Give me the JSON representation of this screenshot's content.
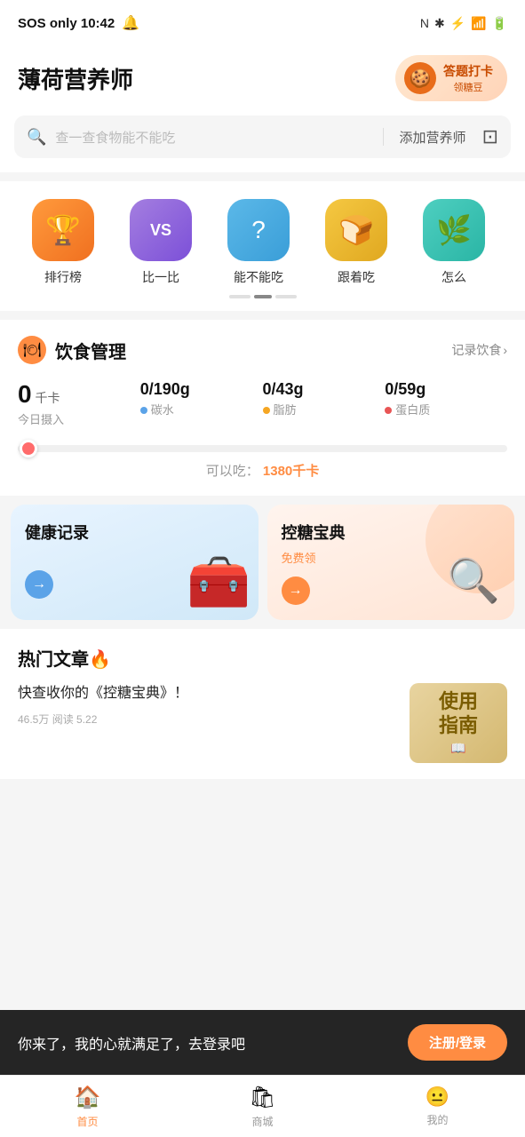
{
  "statusBar": {
    "leftText": "SOS only  10:42",
    "bellIcon": "🔔",
    "rightIcons": "N  *  |||  ◉  🔋"
  },
  "header": {
    "title": "薄荷营养师",
    "badge": {
      "icon": "🍪",
      "mainLabel": "答题打卡",
      "subLabel": "领糖豆"
    }
  },
  "search": {
    "placeholder": "查一查食物能不能吃",
    "addLabel": "添加营养师",
    "scanIcon": "⊡"
  },
  "categories": [
    {
      "id": "ranking",
      "label": "排行榜",
      "icon": "🏆",
      "colorClass": "cat-icon-orange"
    },
    {
      "id": "compare",
      "label": "比一比",
      "icon": "VS",
      "colorClass": "cat-icon-purple"
    },
    {
      "id": "canyoueat",
      "label": "能不能吃",
      "icon": "❓",
      "colorClass": "cat-icon-blue"
    },
    {
      "id": "followeat",
      "label": "跟着吃",
      "icon": "🍞",
      "colorClass": "cat-icon-yellow"
    },
    {
      "id": "howeat",
      "label": "怎么",
      "icon": "🌿",
      "colorClass": "cat-icon-teal"
    }
  ],
  "dietManagement": {
    "title": "饮食管理",
    "linkLabel": "记录饮食",
    "linkArrow": ">",
    "stats": [
      {
        "id": "calories",
        "main": "0",
        "unit": "千卡",
        "sub": "今日摄入",
        "dotClass": ""
      },
      {
        "id": "carbs",
        "value": "0/190g",
        "label": "碳水",
        "dotClass": "dot-blue"
      },
      {
        "id": "fat",
        "value": "0/43g",
        "label": "脂肪",
        "dotClass": "dot-orange"
      },
      {
        "id": "protein",
        "value": "0/59g",
        "label": "蛋白质",
        "dotClass": "dot-red"
      }
    ],
    "canEatLabel": "可以吃：",
    "canEatValue": "1380千卡"
  },
  "cards": [
    {
      "id": "health-record",
      "title": "健康记录",
      "subtitle": "",
      "arrowColor": "blue",
      "decoIcon": "🧰"
    },
    {
      "id": "sugar-control",
      "title": "控糖宝典",
      "subtitle": "免费领",
      "arrowColor": "orange",
      "decoIcon": "🔍"
    }
  ],
  "articles": {
    "title": "热门文章🔥",
    "items": [
      {
        "title": "快查收你的《控糖宝典》！",
        "meta": "46.5万  阅读  5.22",
        "thumb": {
          "line1": "使用",
          "line2": "指南"
        }
      }
    ]
  },
  "loginBanner": {
    "text": "你来了，我的心就满足了，去登录吧",
    "buttonLabel": "注册/登录"
  },
  "bottomNav": [
    {
      "id": "home",
      "icon": "🏠",
      "label": "首页",
      "active": true
    },
    {
      "id": "shop",
      "icon": "🛍",
      "label": "商城",
      "active": false
    },
    {
      "id": "mine",
      "icon": "😐",
      "label": "我的",
      "active": false
    }
  ]
}
